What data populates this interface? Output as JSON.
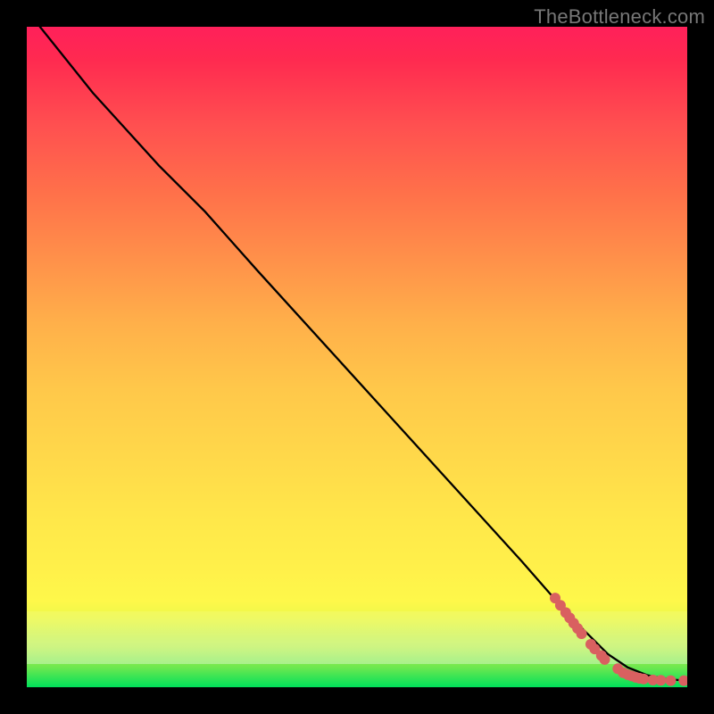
{
  "watermark": "TheBottleneck.com",
  "chart_data": {
    "type": "line",
    "title": "",
    "xlabel": "",
    "ylabel": "",
    "xlim": [
      0,
      100
    ],
    "ylim": [
      0,
      100
    ],
    "grid": false,
    "series": [
      {
        "name": "curve",
        "x": [
          2,
          10,
          20,
          27,
          35,
          45,
          55,
          65,
          75,
          82,
          85,
          88,
          91,
          94,
          97,
          100
        ],
        "y": [
          100,
          90,
          79,
          72,
          63,
          52,
          41,
          30,
          19,
          11,
          8,
          5,
          3,
          1.8,
          1.2,
          1
        ]
      }
    ],
    "scatter_points": {
      "name": "highlight",
      "color": "#d96060",
      "radius": 6,
      "points": [
        {
          "x": 80.0,
          "y": 13.5
        },
        {
          "x": 80.8,
          "y": 12.4
        },
        {
          "x": 81.6,
          "y": 11.3
        },
        {
          "x": 82.2,
          "y": 10.5
        },
        {
          "x": 82.8,
          "y": 9.7
        },
        {
          "x": 83.4,
          "y": 8.9
        },
        {
          "x": 84.0,
          "y": 8.1
        },
        {
          "x": 85.4,
          "y": 6.5
        },
        {
          "x": 86.0,
          "y": 5.8
        },
        {
          "x": 87.0,
          "y": 4.8
        },
        {
          "x": 87.5,
          "y": 4.2
        },
        {
          "x": 89.5,
          "y": 2.8
        },
        {
          "x": 90.3,
          "y": 2.2
        },
        {
          "x": 91.0,
          "y": 1.9
        },
        {
          "x": 91.6,
          "y": 1.7
        },
        {
          "x": 92.2,
          "y": 1.5
        },
        {
          "x": 92.8,
          "y": 1.35
        },
        {
          "x": 93.4,
          "y": 1.25
        },
        {
          "x": 94.8,
          "y": 1.1
        },
        {
          "x": 96.0,
          "y": 1.05
        },
        {
          "x": 97.5,
          "y": 1.0
        },
        {
          "x": 99.5,
          "y": 1.0
        }
      ]
    }
  }
}
